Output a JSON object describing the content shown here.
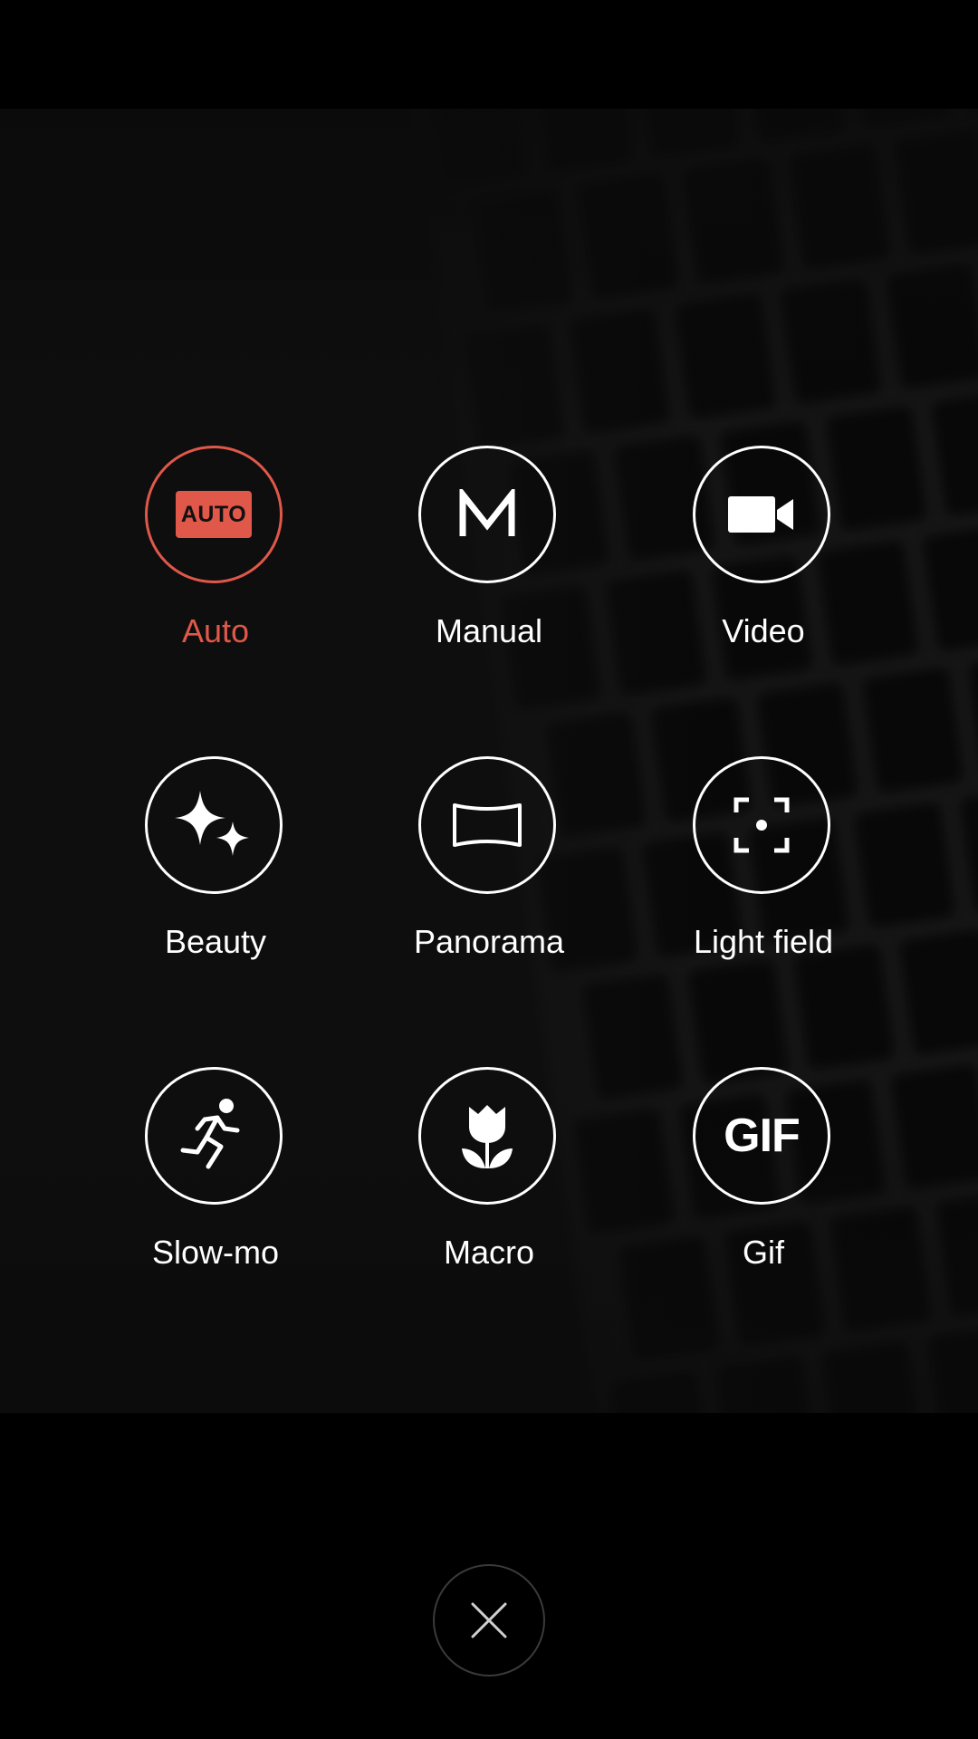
{
  "modes": [
    {
      "id": "auto",
      "label": "Auto",
      "icon": "auto-icon",
      "icon_text": "AUTO",
      "selected": true
    },
    {
      "id": "manual",
      "label": "Manual",
      "icon": "manual-m-icon",
      "selected": false
    },
    {
      "id": "video",
      "label": "Video",
      "icon": "video-camera-icon",
      "selected": false
    },
    {
      "id": "beauty",
      "label": "Beauty",
      "icon": "sparkles-icon",
      "selected": false
    },
    {
      "id": "panorama",
      "label": "Panorama",
      "icon": "panorama-icon",
      "selected": false
    },
    {
      "id": "light-field",
      "label": "Light field",
      "icon": "focus-frame-icon",
      "selected": false
    },
    {
      "id": "slow-mo",
      "label": "Slow-mo",
      "icon": "running-person-icon",
      "selected": false
    },
    {
      "id": "macro",
      "label": "Macro",
      "icon": "tulip-icon",
      "selected": false
    },
    {
      "id": "gif",
      "label": "Gif",
      "icon": "gif-icon",
      "icon_text": "GIF",
      "selected": false
    }
  ],
  "colors": {
    "accent": "#e0584a",
    "foreground": "#ffffff",
    "background": "#000000"
  },
  "close": {
    "icon": "close-icon"
  }
}
